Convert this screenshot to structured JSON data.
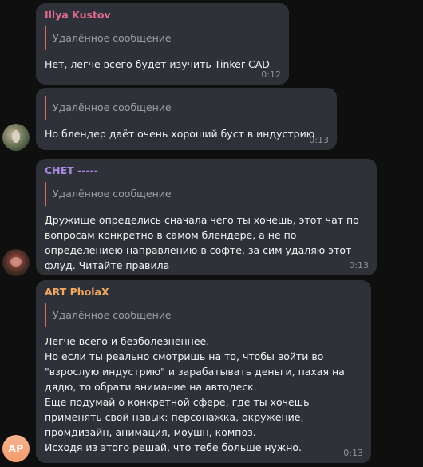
{
  "messages": [
    {
      "sender": "Illya Kustov",
      "sender_color": "#e06a8f",
      "reply_text": "Удалённое сообщение",
      "text": "Нет, легче всего будет изучить Tinker CAD",
      "time": "0:12"
    },
    {
      "sender": "",
      "reply_text": "Удалённое сообщение",
      "text": "Но блендер даёт очень хороший буст в индустрию",
      "time": "0:13"
    },
    {
      "sender": "CHET -----",
      "sender_color": "#a88be0",
      "reply_text": "Удалённое сообщение",
      "text": "Дружище определись сначала чего ты хочешь, этот чат по вопросам конкретно в самом блендере, а не по определениею направлению в софте, за сим удаляю этот флуд. Читайте правила",
      "time": "0:13"
    },
    {
      "sender": "ART PholaX",
      "sender_color": "#f0a860",
      "reply_text": "Удалённое сообщение",
      "text": "Легче всего и безболезненнее.\nНо если ты реально смотришь на то, чтобы войти во \"взрослую индустрию\" и зарабатывать деньги, пахая на дядю, то обрати внимание на автодеск.\nЕще подумай о конкретной сфере, где ты хочешь применять свой навык: персонажка, окружение, промдизайн, анимация, моушн, композ.\nИсходя из этого решай, что тебе больше нужно.",
      "time": "0:13",
      "avatar_initials": "AP"
    }
  ],
  "colors": {
    "background": "#0f0f0f",
    "bubble": "#2e3137",
    "reply_bar": "#d96b5c",
    "reply_text": "#9aa0a7",
    "time": "#8f949a",
    "avatar_ap": "#f29c6d"
  }
}
